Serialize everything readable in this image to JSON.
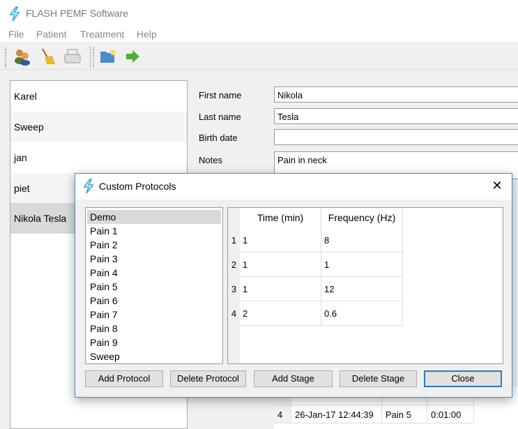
{
  "app": {
    "title": "FLASH PEMF Software",
    "icon": "lightning-icon",
    "accent": "#2fa8d8"
  },
  "menu": [
    "File",
    "Patient",
    "Treatment",
    "Help"
  ],
  "toolbar": [
    "patients-icon",
    "broom-icon",
    "printer-icon",
    "open-folder-icon",
    "arrow-right-icon"
  ],
  "patients": [
    {
      "name": "Karel"
    },
    {
      "name": "Sweep"
    },
    {
      "name": "jan"
    },
    {
      "name": "piet"
    },
    {
      "name": "Nikola Tesla",
      "selected": true
    }
  ],
  "form": {
    "first_name_label": "First name",
    "first_name": "Nikola",
    "last_name_label": "Last name",
    "last_name": "Tesla",
    "birth_date_label": "Birth date",
    "birth_date": "",
    "notes_label": "Notes",
    "notes": "Pain in neck"
  },
  "history_row": {
    "index": "4",
    "date": "26-Jan-17 12:44:39",
    "protocol": "Pain 5",
    "duration": "0:01:00"
  },
  "dialog": {
    "title": "Custom Protocols",
    "protocols": [
      "Demo",
      "Pain 1",
      "Pain 2",
      "Pain 3",
      "Pain 4",
      "Pain 5",
      "Pain 6",
      "Pain 7",
      "Pain 8",
      "Pain 9",
      "Sweep"
    ],
    "selected_protocol": "Demo",
    "columns": [
      "Time (min)",
      "Frequency (Hz)"
    ],
    "stages": [
      {
        "row": "1",
        "time": "1",
        "freq": "8"
      },
      {
        "row": "2",
        "time": "1",
        "freq": "1"
      },
      {
        "row": "3",
        "time": "1",
        "freq": "12"
      },
      {
        "row": "4",
        "time": "2",
        "freq": "0.6"
      }
    ],
    "buttons": {
      "add_protocol": "Add Protocol",
      "delete_protocol": "Delete Protocol",
      "add_stage": "Add Stage",
      "delete_stage": "Delete Stage",
      "close": "Close"
    }
  }
}
